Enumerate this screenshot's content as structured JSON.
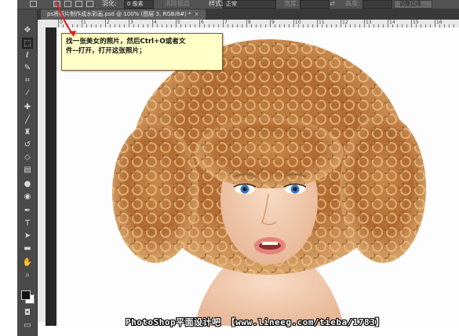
{
  "options_bar": {
    "feather_label": "羽化:",
    "feather_value": "0 像素",
    "antialias_label": "消除锯齿",
    "style_label": "样式:",
    "style_value": "正常",
    "width_label": "宽度:",
    "height_label": "高度:",
    "refine_edge_button": "调整边缘..."
  },
  "document": {
    "tab_title": "ps将照片制作成水彩画.psd @ 100% (图层 3, RGB/8#) *",
    "close_glyph": "×"
  },
  "ruler": {
    "labels": [
      "0",
      "1",
      "2",
      "3",
      "4",
      "5",
      "6",
      "7",
      "8",
      "9",
      "10",
      "11",
      "12",
      "13",
      "14",
      "15",
      "16"
    ]
  },
  "tooltip": {
    "line1": "找一张美女的照片，然后Ctrl+O或者文",
    "line2": "件--打开，打开这张照片；"
  },
  "watermark": {
    "text": "PhotoShop平面设计吧 【www.lineeg.com/tieba/1783】"
  },
  "icons": {
    "move": "move-icon",
    "marquee": "marquee-icon",
    "lasso": "lasso-icon",
    "quick_select": "quick-select-icon",
    "crop": "crop-icon",
    "eyedropper": "eyedropper-icon",
    "healing": "healing-brush-icon",
    "brush": "brush-icon",
    "stamp": "clone-stamp-icon",
    "history_brush": "history-brush-icon",
    "eraser": "eraser-icon",
    "gradient": "gradient-icon",
    "blur": "blur-icon",
    "dodge": "dodge-icon",
    "pen": "pen-icon",
    "type": "type-icon",
    "path_select": "path-select-icon",
    "shape": "shape-icon",
    "hand": "hand-icon",
    "zoom": "zoom-icon"
  },
  "colors": {
    "app_dark": "#535353",
    "tooltip_bg": "#ffffc8",
    "arrow": "#e0201c",
    "foreground_color": "#111111",
    "background_color": "#ffffff"
  }
}
